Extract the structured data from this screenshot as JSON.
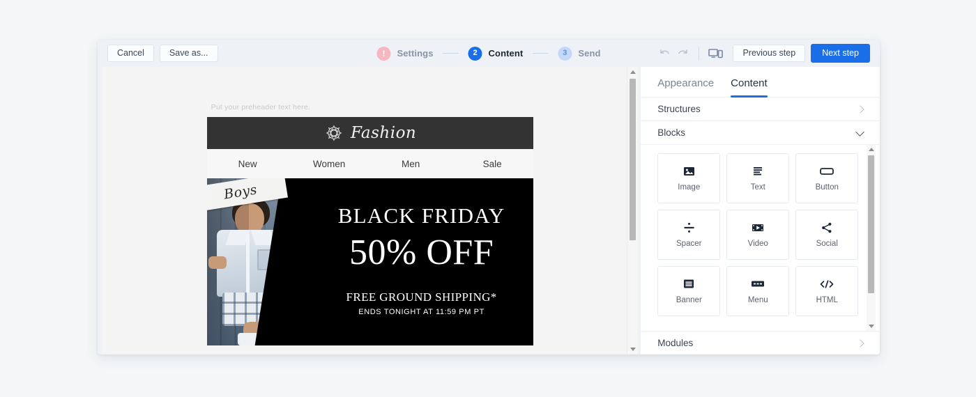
{
  "toolbar": {
    "cancel_label": "Cancel",
    "save_as_label": "Save as...",
    "undo_icon": "undo-icon",
    "redo_icon": "redo-icon",
    "device_preview_icon": "device-preview-icon",
    "previous_step_label": "Previous step",
    "next_step_label": "Next step",
    "next_step_color": "#1a6ee8"
  },
  "steps": [
    {
      "badge": "!",
      "label": "Settings",
      "state": "error",
      "badge_color": "#f8b6c0"
    },
    {
      "badge": "2",
      "label": "Content",
      "state": "active",
      "badge_color": "#1a6ee8"
    },
    {
      "badge": "3",
      "label": "Send",
      "state": "upcoming",
      "badge_color": "#c3d9f7"
    }
  ],
  "email": {
    "preheader": "Put your preheader text here.",
    "logo_text": "Fashion",
    "logo_icon": "star-flower-logo-icon",
    "header_bg": "#333333",
    "nav": [
      "New",
      "Women",
      "Men",
      "Sale"
    ],
    "hero": {
      "photo_tag": "Boys",
      "title": "BLACK FRIDAY",
      "discount": "50% OFF",
      "shipping": "FREE GROUND SHIPPING*",
      "ends": "ENDS TONIGHT AT 11:59 PM PT",
      "bg": "#000000"
    }
  },
  "panel": {
    "tabs": [
      {
        "label": "Appearance",
        "active": false
      },
      {
        "label": "Content",
        "active": true
      }
    ],
    "structures_label": "Structures",
    "blocks_label": "Blocks",
    "modules_label": "Modules",
    "accent": "#1a6ee8",
    "blocks": [
      {
        "label": "Image",
        "icon": "image-icon"
      },
      {
        "label": "Text",
        "icon": "text-icon"
      },
      {
        "label": "Button",
        "icon": "button-icon"
      },
      {
        "label": "Spacer",
        "icon": "spacer-icon"
      },
      {
        "label": "Video",
        "icon": "video-icon"
      },
      {
        "label": "Social",
        "icon": "social-share-icon"
      },
      {
        "label": "Banner",
        "icon": "banner-icon"
      },
      {
        "label": "Menu",
        "icon": "menu-icon"
      },
      {
        "label": "HTML",
        "icon": "html-code-icon"
      }
    ]
  }
}
